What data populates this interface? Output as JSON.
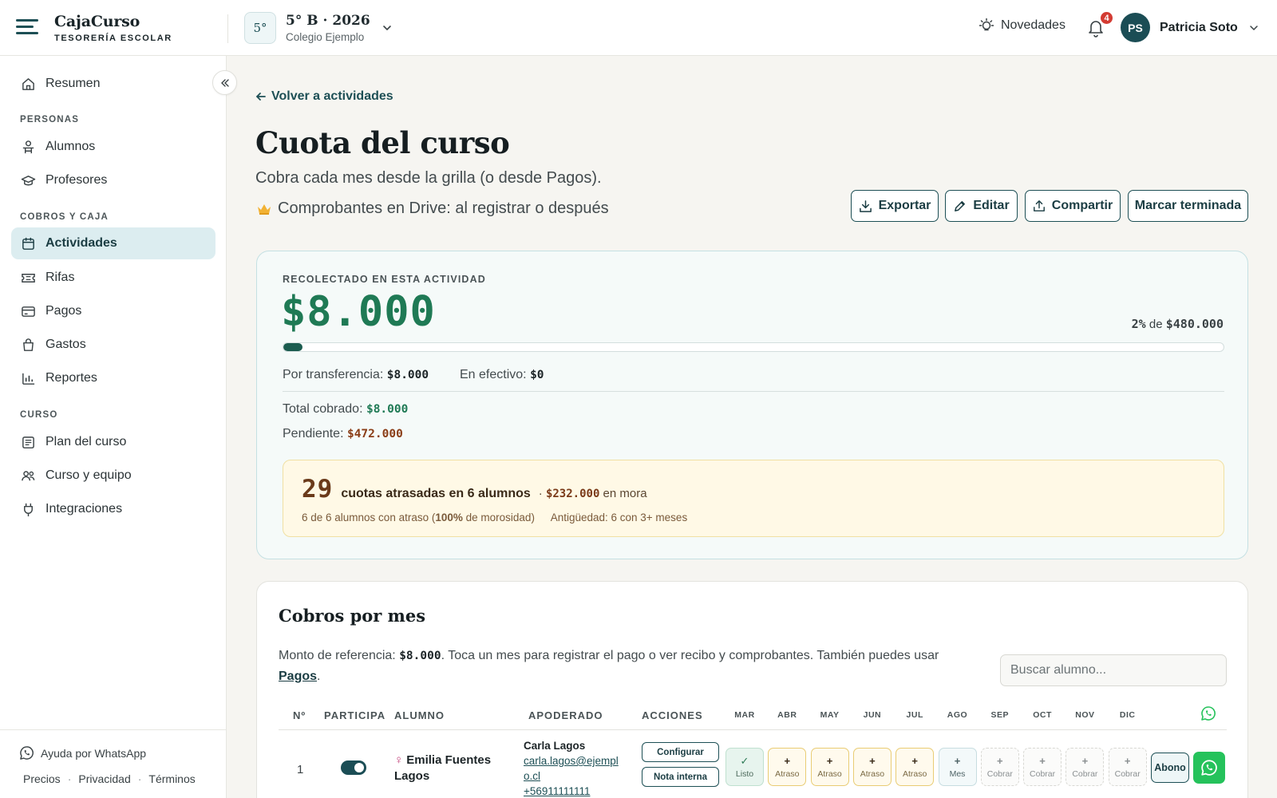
{
  "brand": {
    "name": "CajaCurso",
    "tagline": "TESORERÍA ESCOLAR"
  },
  "course": {
    "badge": "5°",
    "title": "5° B · 2026",
    "school": "Colegio Ejemplo"
  },
  "header": {
    "novedades": "Novedades",
    "notifications": "4",
    "user_initials": "PS",
    "user_name": "Patricia Soto"
  },
  "sidebar": {
    "items": {
      "resumen": "Resumen",
      "alumnos": "Alumnos",
      "profesores": "Profesores",
      "actividades": "Actividades",
      "rifas": "Rifas",
      "pagos": "Pagos",
      "gastos": "Gastos",
      "reportes": "Reportes",
      "plan": "Plan del curso",
      "equipo": "Curso y equipo",
      "integraciones": "Integraciones"
    },
    "sections": {
      "personas": "PERSONAS",
      "cobros": "COBROS Y CAJA",
      "curso": "CURSO"
    },
    "footer": {
      "whatsapp": "Ayuda por WhatsApp",
      "precios": "Precios",
      "privacidad": "Privacidad",
      "terminos": "Términos",
      "sep": "·"
    }
  },
  "page": {
    "back": "Volver a actividades",
    "title": "Cuota del curso",
    "subtitle": "Cobra cada mes desde la grilla (o desde Pagos).",
    "drive_note": "Comprobantes en Drive: al registrar o después",
    "actions": {
      "export": "Exportar",
      "edit": "Editar",
      "share": "Compartir",
      "finish": "Marcar terminada"
    }
  },
  "summary": {
    "label": "RECOLECTADO EN ESTA ACTIVIDAD",
    "amount": "$8.000",
    "percent": "2%",
    "of": "de",
    "goal": "$480.000",
    "progress": 0.02,
    "transfer_label": "Por transferencia:",
    "transfer_value": "$8.000",
    "cash_label": "En efectivo:",
    "cash_value": "$0",
    "total_label": "Total cobrado:",
    "total_value": "$8.000",
    "pending_label": "Pendiente:",
    "pending_value": "$472.000"
  },
  "mora": {
    "count": "29",
    "text": "cuotas atrasadas en 6 alumnos",
    "dot": "·",
    "amount": "$232.000",
    "amount_suffix": "en mora",
    "detail_a": "6 de 6 alumnos con atraso (",
    "detail_pct": "100%",
    "detail_b": " de morosidad)",
    "antiguedad": "Antigüedad: 6 con 3+ meses"
  },
  "cobros": {
    "title": "Cobros por mes",
    "desc_a": "Monto de referencia: ",
    "ref_amount": "$8.000",
    "desc_b": ". Toca un mes para registrar el pago o ver recibo y comprobantes. También puedes usar ",
    "desc_link": "Pagos",
    "desc_c": ".",
    "search_placeholder": "Buscar alumno...",
    "columns": {
      "num": "Nº",
      "participa": "PARTICIPA",
      "alumno": "ALUMNO",
      "apoderado": "APODERADO",
      "acciones": "ACCIONES"
    },
    "months": [
      "MAR",
      "ABR",
      "MAY",
      "JUN",
      "JUL",
      "AGO",
      "SEP",
      "OCT",
      "NOV",
      "DIC"
    ],
    "row": {
      "num": "1",
      "gender": "♀",
      "name": "Emilia Fuentes Lagos",
      "guardian": "Carla Lagos",
      "email": "carla.lagos@ejemplo.cl",
      "phone": "+56911111111",
      "configure": "Configurar",
      "note": "Nota interna",
      "cells": [
        {
          "sym": "✓",
          "label": "Listo",
          "state": "listo"
        },
        {
          "sym": "+",
          "label": "Atraso",
          "state": "atraso"
        },
        {
          "sym": "+",
          "label": "Atraso",
          "state": "atraso"
        },
        {
          "sym": "+",
          "label": "Atraso",
          "state": "atraso"
        },
        {
          "sym": "+",
          "label": "Atraso",
          "state": "atraso"
        },
        {
          "sym": "+",
          "label": "Mes",
          "state": "mes"
        },
        {
          "sym": "+",
          "label": "Cobrar",
          "state": "cobrar"
        },
        {
          "sym": "+",
          "label": "Cobrar",
          "state": "cobrar"
        },
        {
          "sym": "+",
          "label": "Cobrar",
          "state": "cobrar"
        },
        {
          "sym": "+",
          "label": "Cobrar",
          "state": "cobrar"
        }
      ],
      "abono": "Abono"
    }
  },
  "colors": {
    "accent": "#1d4f55",
    "success": "#1f7a55",
    "warning": "#8a3d17",
    "whatsapp": "#25c25b"
  }
}
